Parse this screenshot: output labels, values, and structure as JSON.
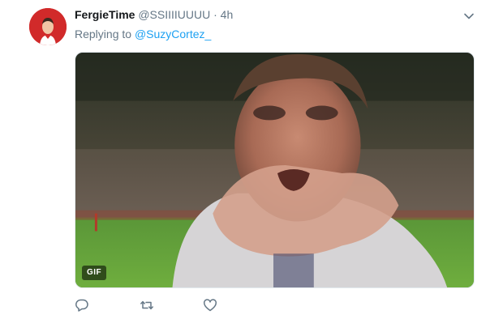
{
  "tweet": {
    "display_name": "FergieTime",
    "handle": "@SSIIIIUUUU",
    "separator": "·",
    "time": "4h",
    "replying_prefix": "Replying to",
    "replying_to": "@SuzyCortez_",
    "media_badge": "GIF"
  },
  "icons": {
    "caret": "chevron-down-icon",
    "reply": "reply-icon",
    "retweet": "retweet-icon",
    "like": "heart-icon"
  },
  "colors": {
    "name": "#14171a",
    "secondary": "#657786",
    "link": "#1da1f2",
    "avatar_bg": "#d12a2a"
  }
}
